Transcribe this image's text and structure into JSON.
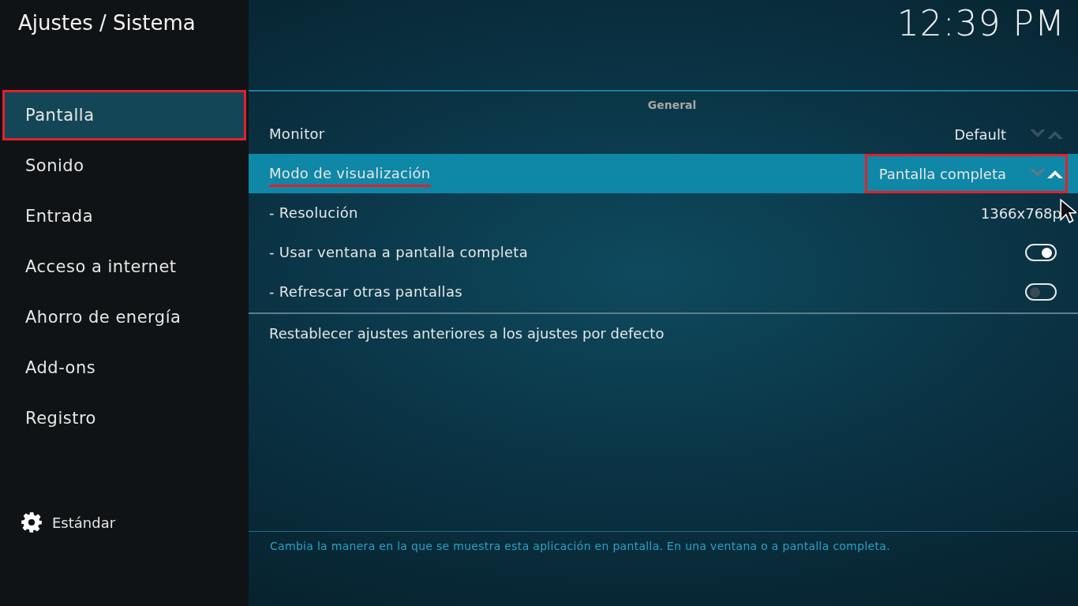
{
  "header": {
    "title": "Ajustes / Sistema",
    "clock": "12:39 PM"
  },
  "sidebar": {
    "items": [
      {
        "label": "Pantalla",
        "selected": true,
        "annotated": true
      },
      {
        "label": "Sonido",
        "selected": false,
        "annotated": false
      },
      {
        "label": "Entrada",
        "selected": false,
        "annotated": false
      },
      {
        "label": "Acceso a internet",
        "selected": false,
        "annotated": false
      },
      {
        "label": "Ahorro de energía",
        "selected": false,
        "annotated": false
      },
      {
        "label": "Add-ons",
        "selected": false,
        "annotated": false
      },
      {
        "label": "Registro",
        "selected": false,
        "annotated": false
      }
    ],
    "level": {
      "label": "Estándar"
    }
  },
  "section": {
    "title": "General"
  },
  "settings": [
    {
      "kind": "spinner",
      "label": "Monitor",
      "value": "Default",
      "selected": false,
      "annotated": false
    },
    {
      "kind": "spinner",
      "label": "Modo de visualización",
      "value": "Pantalla completa",
      "selected": true,
      "annotated": true
    },
    {
      "kind": "value",
      "label": "- Resolución",
      "value": "1366x768p",
      "selected": false,
      "annotated": false
    },
    {
      "kind": "toggle",
      "label": "- Usar ventana a pantalla completa",
      "on": true,
      "selected": false,
      "annotated": false
    },
    {
      "kind": "toggle",
      "label": "- Refrescar otras pantallas",
      "on": false,
      "selected": false,
      "annotated": false
    }
  ],
  "reset": {
    "label": "Restablecer ajustes anteriores a los ajustes por defecto"
  },
  "help": {
    "text": "Cambia la manera en la que se muestra esta aplicación en pantalla. En una ventana o a pantalla completa."
  }
}
